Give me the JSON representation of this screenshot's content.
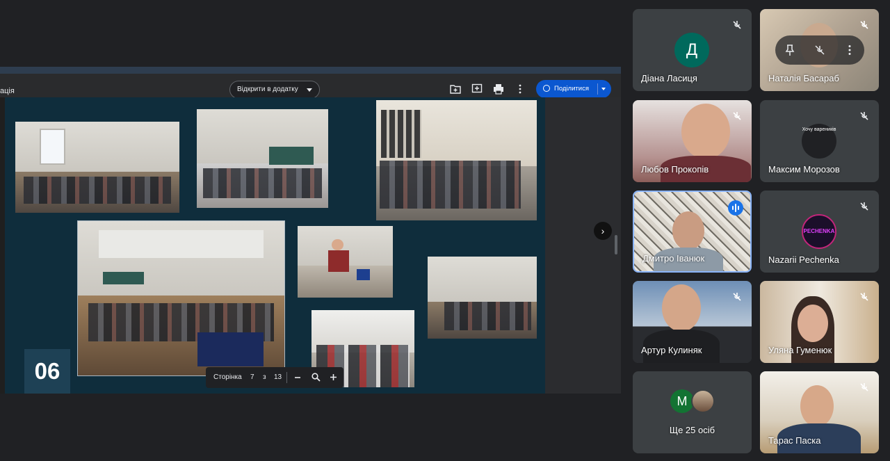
{
  "viewer": {
    "title_fragment": "ація",
    "open_in_app": "Відкрити в додатку",
    "share": "Поділитися"
  },
  "slide": {
    "number": "06",
    "page_label": "Сторінка",
    "current_page": "7",
    "page_of": "з",
    "total_pages": "13"
  },
  "participants": [
    {
      "name": "Діана Ласиця",
      "initial": "Д",
      "avatar_color": "#00695c",
      "muted": true
    },
    {
      "name": "Наталія Басараб",
      "muted": true
    },
    {
      "name": "Любов Прокопів",
      "muted": true
    },
    {
      "name": "Максим Морозов",
      "muted": true,
      "avatar_text": "Хочу вареників"
    },
    {
      "name": "Дмитро Іванюк",
      "speaking": true
    },
    {
      "name": "Nazarii Pechenka",
      "muted": true,
      "avatar_text": "PECHENKA"
    },
    {
      "name": "Артур Кулиняк",
      "muted": true
    },
    {
      "name": "Уляна Гуменюк",
      "muted": true
    },
    {
      "more": "Ще 25 осіб",
      "initial": "М",
      "avatar_color": "#137333"
    },
    {
      "name": "Тарас Паска",
      "muted": true
    }
  ],
  "colors": {
    "accent": "#0b57d0",
    "speaking": "#8ab4f8",
    "slide_bg": "#0f2d3c",
    "tile_bg": "#3c4043"
  }
}
